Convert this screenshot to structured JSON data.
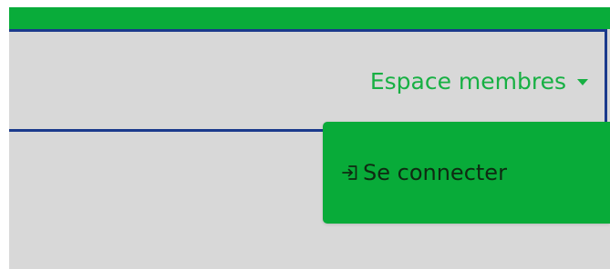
{
  "navbar": {
    "members_menu": {
      "label": "Espace membres",
      "caret_icon": "caret-down-icon",
      "items": [
        {
          "icon": "login-icon",
          "label": "Se connecter"
        }
      ]
    }
  },
  "colors": {
    "accent_green": "#09ac3a",
    "link_green": "#17b043",
    "navbar_border": "#1b3a8c",
    "background_gray": "#d8d8d8",
    "dropdown_text": "#0f2a12"
  }
}
